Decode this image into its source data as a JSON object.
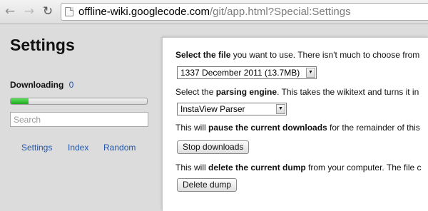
{
  "browser": {
    "url_host": "offline-wiki.googlecode.com",
    "url_path": "/git/app.html?Special:Settings",
    "back_glyph": "←",
    "forward_glyph": "→",
    "reload_glyph": "↻"
  },
  "sidebar": {
    "title": "Settings",
    "downloading_label": "Downloading",
    "downloading_count": "0",
    "progress_fraction": 0.13,
    "search_placeholder": "Search",
    "nav": [
      "Settings",
      "Index",
      "Random"
    ]
  },
  "main": {
    "file_prefix_bold": "Select the file",
    "file_suffix": " you want to use. There isn't much to choose from",
    "file_selected": "1337 December 2011 (13.7MB)",
    "parser_prefix": "Select the ",
    "parser_bold": "parsing engine",
    "parser_suffix": ". This takes the wikitext and turns it in",
    "parser_selected": "InstaView Parser",
    "pause_prefix": "This will ",
    "pause_bold": "pause the current downloads",
    "pause_suffix": " for the remainder of this",
    "stop_button": "Stop downloads",
    "delete_prefix": "This will ",
    "delete_bold": "delete the current dump",
    "delete_suffix": " from your computer. The file c",
    "delete_button": "Delete dump"
  },
  "colors": {
    "link": "#2255aa",
    "progress": "#2db82d"
  }
}
